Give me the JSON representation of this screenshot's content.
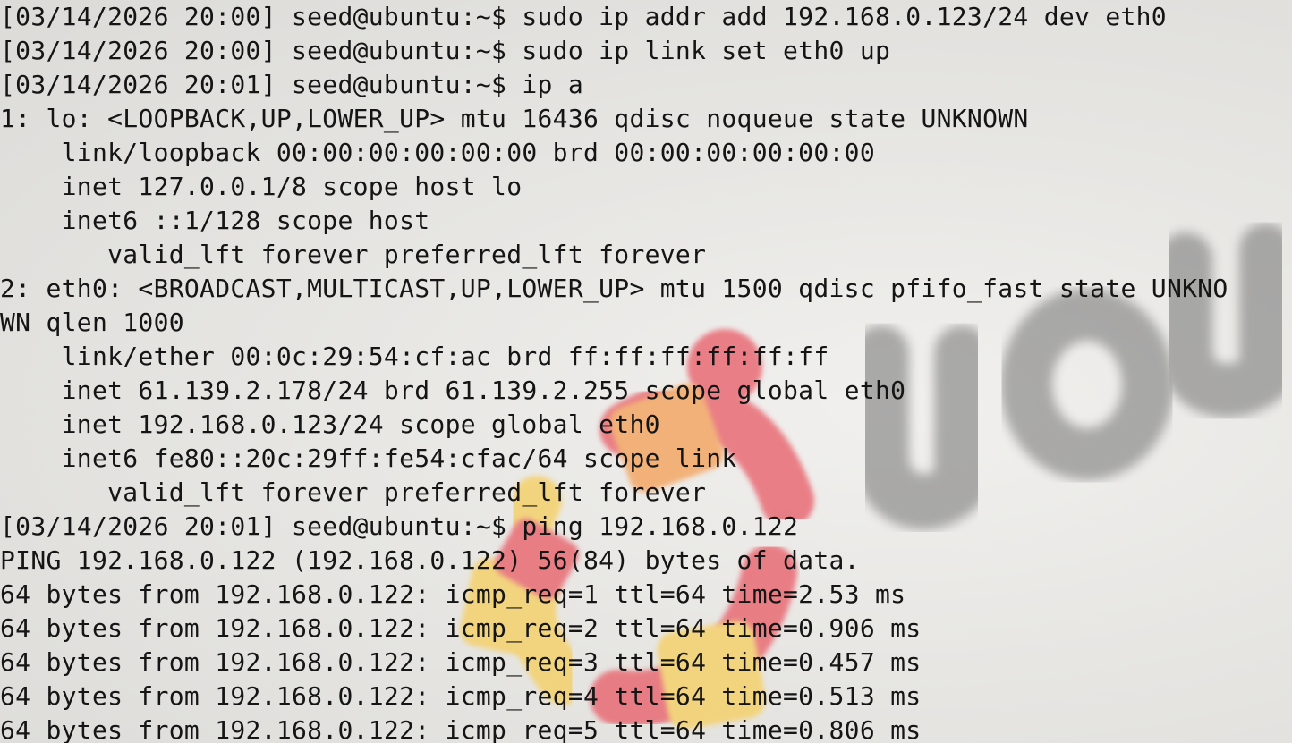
{
  "terminal": {
    "lines": [
      "[03/14/2026 20:00] seed@ubuntu:~$ sudo ip addr add 192.168.0.123/24 dev eth0",
      "[03/14/2026 20:00] seed@ubuntu:~$ sudo ip link set eth0 up",
      "[03/14/2026 20:01] seed@ubuntu:~$ ip a",
      "1: lo: <LOOPBACK,UP,LOWER_UP> mtu 16436 qdisc noqueue state UNKNOWN",
      "    link/loopback 00:00:00:00:00:00 brd 00:00:00:00:00:00",
      "    inet 127.0.0.1/8 scope host lo",
      "    inet6 ::1/128 scope host",
      "       valid_lft forever preferred_lft forever",
      "2: eth0: <BROADCAST,MULTICAST,UP,LOWER_UP> mtu 1500 qdisc pfifo_fast state UNKNO",
      "WN qlen 1000",
      "    link/ether 00:0c:29:54:cf:ac brd ff:ff:ff:ff:ff:ff",
      "    inet 61.139.2.178/24 brd 61.139.2.255 scope global eth0",
      "    inet 192.168.0.123/24 scope global eth0",
      "    inet6 fe80::20c:29ff:fe54:cfac/64 scope link",
      "       valid_lft forever preferred_lft forever",
      "[03/14/2026 20:01] seed@ubuntu:~$ ping 192.168.0.122",
      "PING 192.168.0.122 (192.168.0.122) 56(84) bytes of data.",
      "64 bytes from 192.168.0.122: icmp_req=1 ttl=64 time=2.53 ms",
      "64 bytes from 192.168.0.122: icmp_req=2 ttl=64 time=0.906 ms",
      "64 bytes from 192.168.0.122: icmp_req=3 ttl=64 time=0.457 ms",
      "64 bytes from 192.168.0.122: icmp_req=4 ttl=64 time=0.513 ms",
      "64 bytes from 192.168.0.122: icmp_req=5 ttl=64 time=0.806 ms"
    ]
  },
  "wallpaper": {
    "logo_text": "ubu",
    "colors": {
      "background": "#e6e5e2",
      "logo_red": "#e8606a",
      "logo_orange": "#f4a15a",
      "logo_yellow": "#f6cf62",
      "wordmark_gray": "#8a8a8a"
    }
  }
}
